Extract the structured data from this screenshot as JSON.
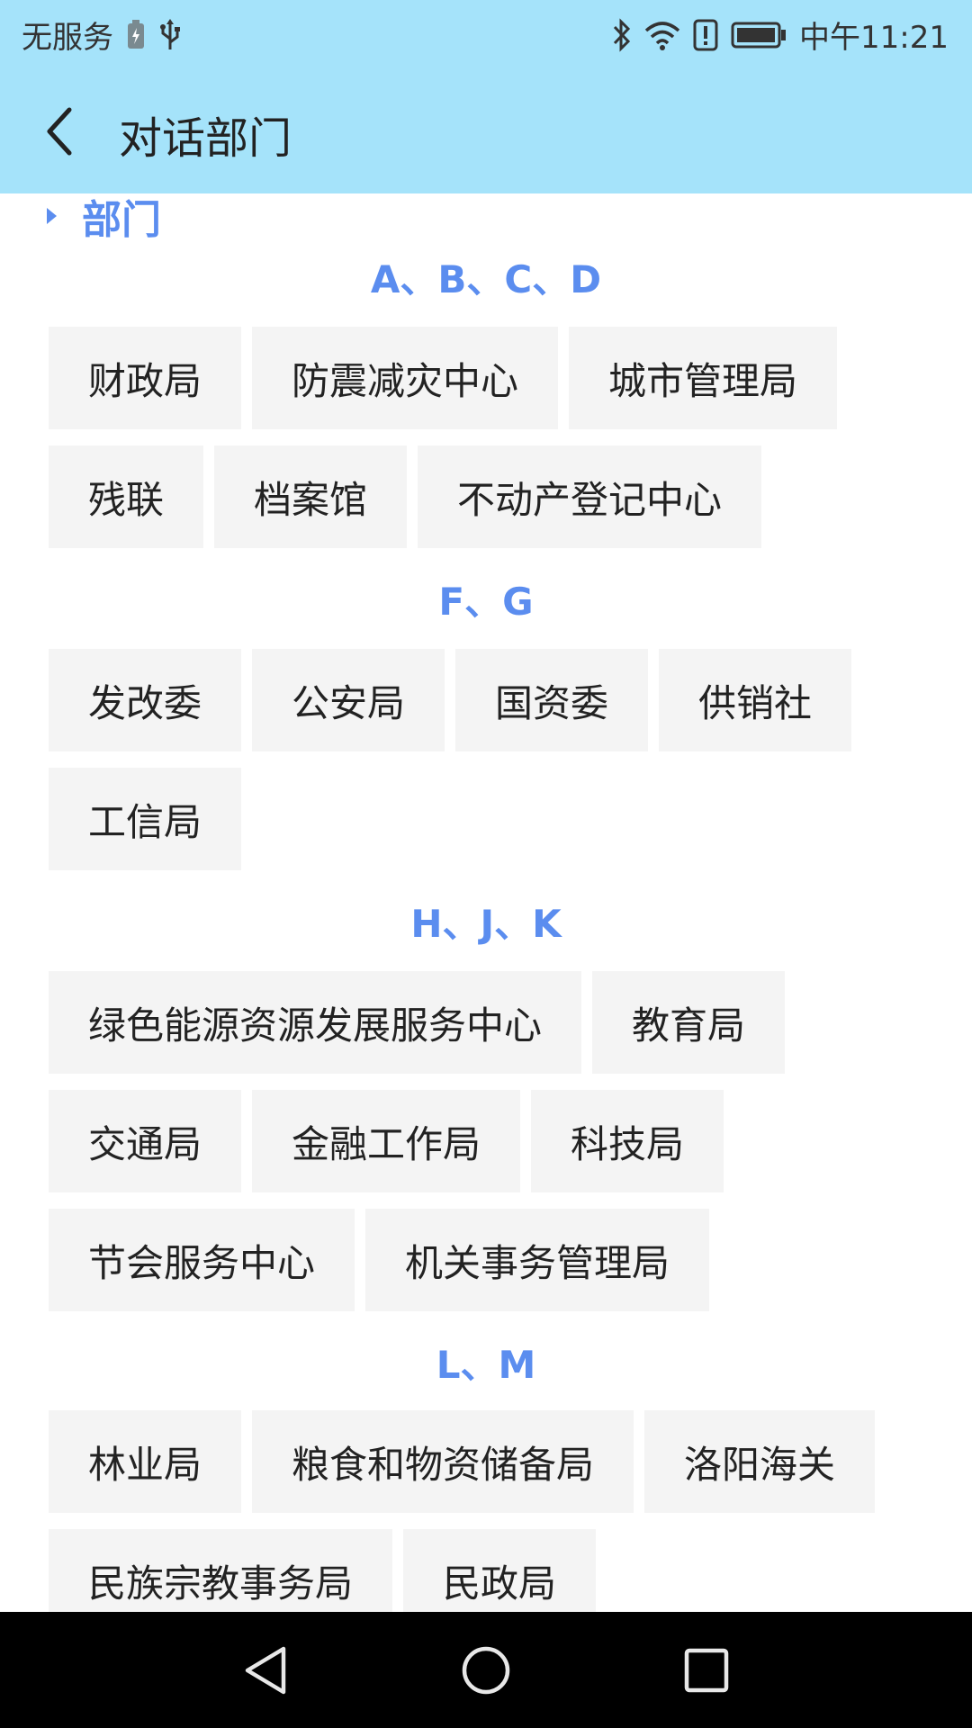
{
  "status_bar": {
    "carrier": "无服务",
    "time": "中午11:21",
    "icons": [
      "battery-charging-icon",
      "usb-icon",
      "bluetooth-icon",
      "wifi-icon",
      "alert-icon",
      "battery-icon"
    ]
  },
  "app_bar": {
    "title": "对话部门",
    "back_icon": "back-arrow-icon"
  },
  "section": {
    "title": "部门"
  },
  "groups": [
    {
      "letters": "A、B、C、D",
      "rows": [
        [
          "财政局",
          "防震减灾中心",
          "城市管理局"
        ],
        [
          "残联",
          "档案馆",
          "不动产登记中心"
        ]
      ]
    },
    {
      "letters": "F、G",
      "rows": [
        [
          "发改委",
          "公安局",
          "国资委",
          "供销社"
        ],
        [
          "工信局"
        ]
      ]
    },
    {
      "letters": "H、J、K",
      "rows": [
        [
          "绿色能源资源发展服务中心",
          "教育局"
        ],
        [
          "交通局",
          "金融工作局",
          "科技局"
        ],
        [
          "节会服务中心",
          "机关事务管理局"
        ]
      ]
    },
    {
      "letters": "L、M",
      "rows": [
        [
          "林业局",
          "粮食和物资储备局",
          "洛阳海关"
        ],
        [
          "民族宗教事务局",
          "民政局"
        ]
      ]
    }
  ],
  "nav_bar": {
    "icons": [
      "nav-back-icon",
      "nav-home-icon",
      "nav-recents-icon"
    ]
  },
  "colors": {
    "header_bg": "#a5e3fa",
    "accent": "#5b8def",
    "chip_bg": "#f4f4f4",
    "nav_bg": "#000000"
  }
}
